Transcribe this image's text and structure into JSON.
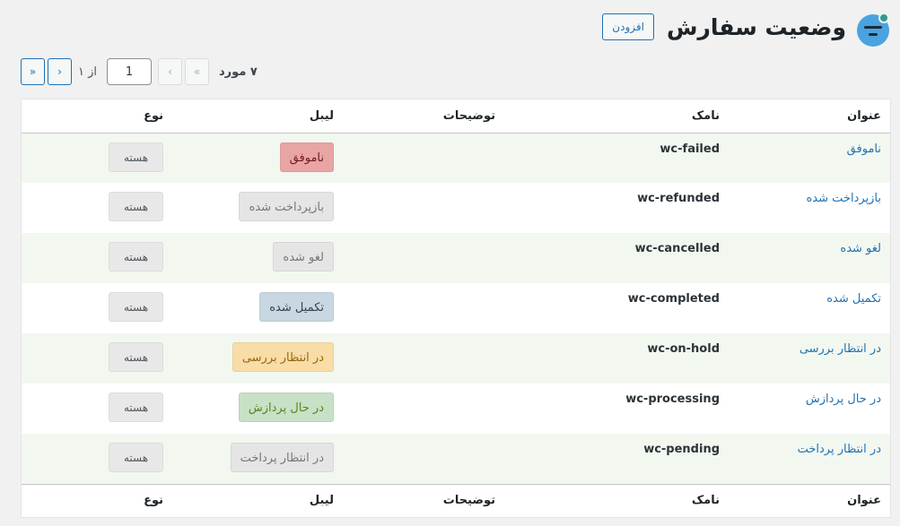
{
  "header": {
    "title": "وضعیت سفارش",
    "add_label": "افزودن"
  },
  "pagination": {
    "count_text": "۷ مورد",
    "first": "«",
    "prev": "‹",
    "current_page": "1",
    "of_text": "از ۱",
    "next": "›",
    "last": "»"
  },
  "table": {
    "columns": {
      "title": "عنوان",
      "slug": "نامک",
      "description": "توضیحات",
      "label": "لیبل",
      "type": "نوع"
    },
    "rows": [
      {
        "title": "ناموفق",
        "slug": "wc-failed",
        "label": "ناموفق",
        "label_bg": "#e9a4a4",
        "label_fg": "#761919",
        "type": "هسته"
      },
      {
        "title": "بازپرداخت شده",
        "slug": "wc-refunded",
        "label": "بازپرداخت شده",
        "label_bg": "#e5e5e5",
        "label_fg": "#777777",
        "type": "هسته"
      },
      {
        "title": "لغو شده",
        "slug": "wc-cancelled",
        "label": "لغو شده",
        "label_bg": "#e5e5e5",
        "label_fg": "#777777",
        "type": "هسته"
      },
      {
        "title": "تکمیل شده",
        "slug": "wc-completed",
        "label": "تکمیل شده",
        "label_bg": "#c8d7e1",
        "label_fg": "#2e4453",
        "type": "هسته"
      },
      {
        "title": "در انتظار بررسی",
        "slug": "wc-on-hold",
        "label": "در انتظار بررسی",
        "label_bg": "#f8dda7",
        "label_fg": "#94660c",
        "type": "هسته"
      },
      {
        "title": "در حال پردازش",
        "slug": "wc-processing",
        "label": "در حال پردازش",
        "label_bg": "#c6e1c6",
        "label_fg": "#5b841b",
        "type": "هسته"
      },
      {
        "title": "در انتظار پرداخت",
        "slug": "wc-pending",
        "label": "در انتظار پرداخت",
        "label_bg": "#e5e5e5",
        "label_fg": "#777777",
        "type": "هسته"
      }
    ]
  }
}
